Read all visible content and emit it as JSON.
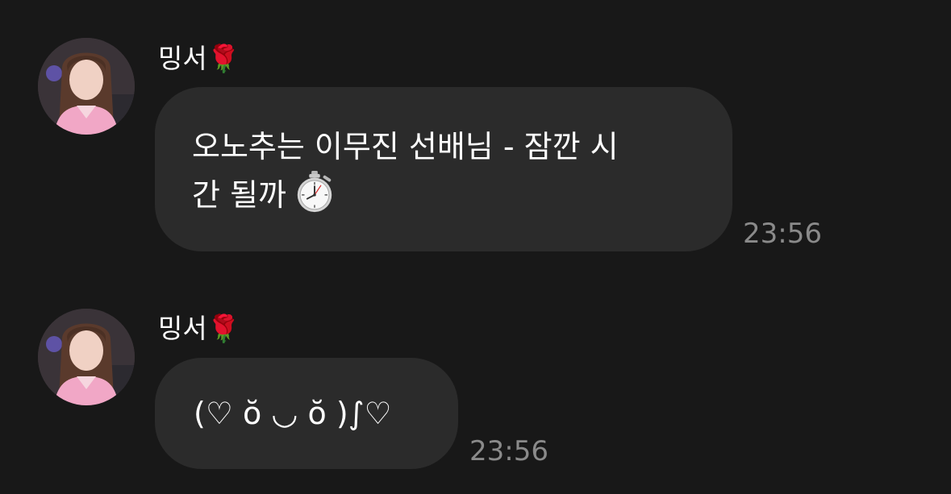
{
  "messages": [
    {
      "sender": "밍서🌹",
      "text": "오노추는 이무진 선배님 - 잠깐 시간 될까",
      "text_line1": "오노추는 이무진 선배님 - 잠깐 시",
      "text_line2": "간 될까",
      "icon": "stopwatch-icon",
      "time": "23:56"
    },
    {
      "sender": "밍서🌹",
      "text": "(♡ ŏ ◡ ŏ )∫♡",
      "time": "23:56"
    }
  ],
  "colors": {
    "background": "#181818",
    "bubble": "#2b2b2b",
    "timestamp": "#8a8a8a",
    "text": "#ffffff"
  }
}
